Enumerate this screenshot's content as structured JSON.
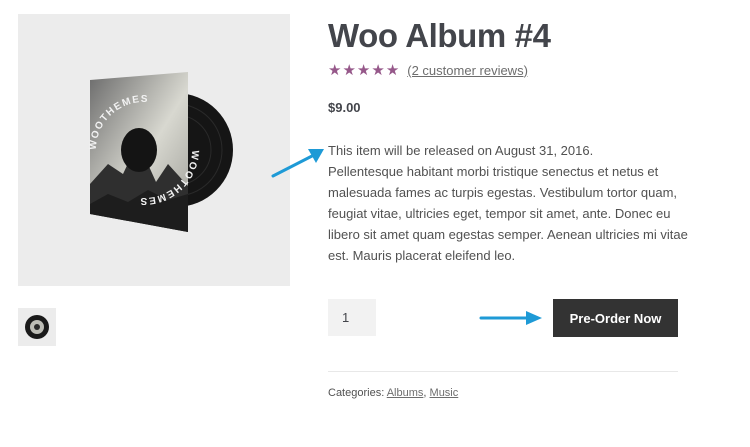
{
  "product": {
    "title": "Woo Album #4",
    "rating": {
      "value": 5,
      "max": 5,
      "star_glyph": "★",
      "color": "#96588a"
    },
    "reviews_link": "(2 customer reviews)",
    "price": "$9.00",
    "description_lines": [
      "This item will be released on August 31, 2016.",
      "Pellentesque habitant morbi tristique senectus et netus et malesuada fames ac turpis egestas. Vestibulum tortor quam, feugiat vitae, ultricies eget, tempor sit amet, ante. Donec eu libero sit amet quam egestas semper. Aenean ultricies mi vitae est. Mauris placerat eleifend leo."
    ],
    "quantity": "1",
    "preorder_label": "Pre-Order Now",
    "categories_label": "Categories:",
    "categories": [
      "Albums",
      "Music"
    ],
    "categories_separator": ", "
  },
  "gallery": {
    "main_image": {
      "icon": "vinyl-record-image",
      "sleeve_text": "WOOTHEMES"
    },
    "thumbnail": {
      "icon": "vinyl-thumbnail-icon"
    }
  },
  "annotations": {
    "arrow_icon": "annotation-arrow-icon",
    "color": "#1e9ad6"
  },
  "colors": {
    "button_bg": "#333333",
    "title": "#43454b",
    "star": "#96588a",
    "arrow": "#1e9ad6"
  }
}
